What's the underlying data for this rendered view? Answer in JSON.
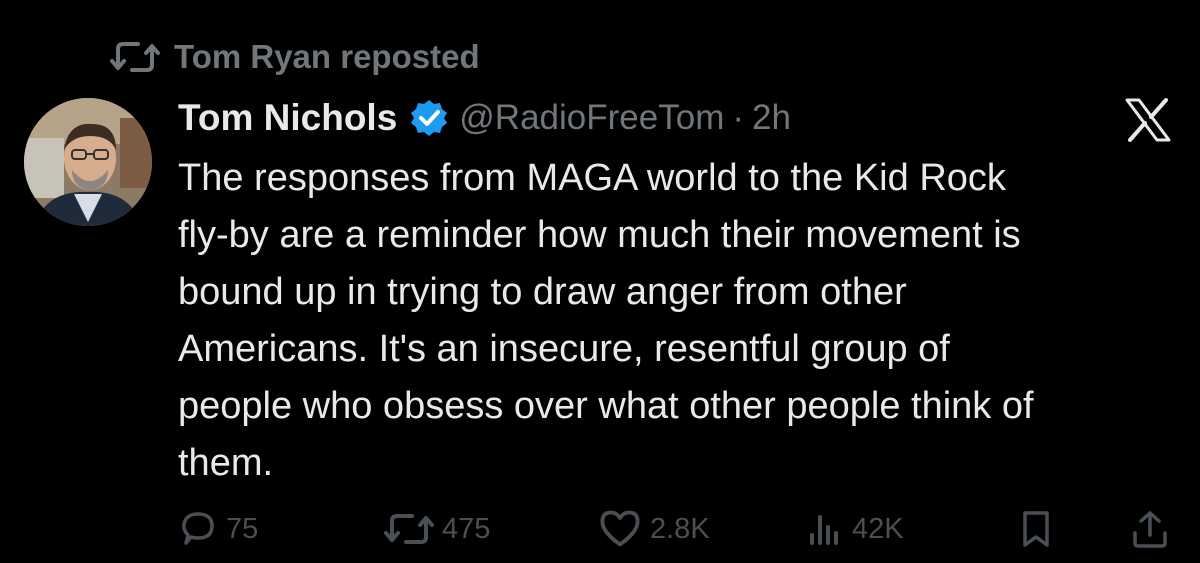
{
  "repost": {
    "text": "Tom Ryan reposted",
    "icon": "repost-icon"
  },
  "author": {
    "name": "Tom Nichols",
    "handle": "@RadioFreeTom",
    "separator": "·",
    "time": "2h",
    "verified": true,
    "verified_color": "#1d9bf0"
  },
  "platform_logo": "x-logo",
  "tweet": {
    "text": "The responses from MAGA world to the Kid Rock\nfly-by are a reminder how much their movement is\nbound up in trying to draw anger from other\nAmericans. It's an insecure, resentful group of\npeople who obsess over what other people think of\nthem."
  },
  "actions": {
    "replies": "75",
    "reposts": "475",
    "likes": "2.8K",
    "views": "42K"
  },
  "colors": {
    "background": "#000000",
    "text": "#e7e9ea",
    "secondary": "#71767b",
    "action_dim": "#4a4f55"
  }
}
